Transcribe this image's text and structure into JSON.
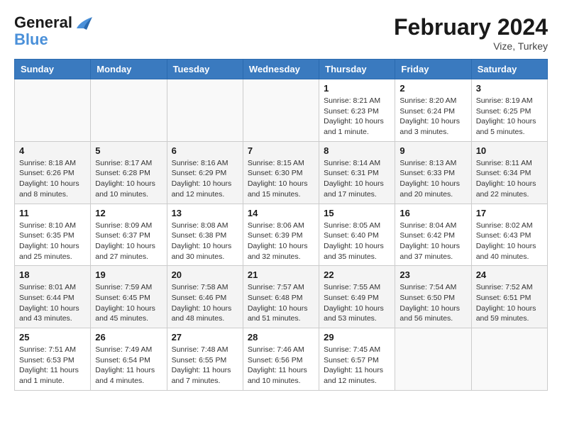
{
  "logo": {
    "line1": "General",
    "line2": "Blue"
  },
  "title": "February 2024",
  "subtitle": "Vize, Turkey",
  "weekdays": [
    "Sunday",
    "Monday",
    "Tuesday",
    "Wednesday",
    "Thursday",
    "Friday",
    "Saturday"
  ],
  "weeks": [
    [
      {
        "day": "",
        "info": ""
      },
      {
        "day": "",
        "info": ""
      },
      {
        "day": "",
        "info": ""
      },
      {
        "day": "",
        "info": ""
      },
      {
        "day": "1",
        "info": "Sunrise: 8:21 AM\nSunset: 6:23 PM\nDaylight: 10 hours\nand 1 minute."
      },
      {
        "day": "2",
        "info": "Sunrise: 8:20 AM\nSunset: 6:24 PM\nDaylight: 10 hours\nand 3 minutes."
      },
      {
        "day": "3",
        "info": "Sunrise: 8:19 AM\nSunset: 6:25 PM\nDaylight: 10 hours\nand 5 minutes."
      }
    ],
    [
      {
        "day": "4",
        "info": "Sunrise: 8:18 AM\nSunset: 6:26 PM\nDaylight: 10 hours\nand 8 minutes."
      },
      {
        "day": "5",
        "info": "Sunrise: 8:17 AM\nSunset: 6:28 PM\nDaylight: 10 hours\nand 10 minutes."
      },
      {
        "day": "6",
        "info": "Sunrise: 8:16 AM\nSunset: 6:29 PM\nDaylight: 10 hours\nand 12 minutes."
      },
      {
        "day": "7",
        "info": "Sunrise: 8:15 AM\nSunset: 6:30 PM\nDaylight: 10 hours\nand 15 minutes."
      },
      {
        "day": "8",
        "info": "Sunrise: 8:14 AM\nSunset: 6:31 PM\nDaylight: 10 hours\nand 17 minutes."
      },
      {
        "day": "9",
        "info": "Sunrise: 8:13 AM\nSunset: 6:33 PM\nDaylight: 10 hours\nand 20 minutes."
      },
      {
        "day": "10",
        "info": "Sunrise: 8:11 AM\nSunset: 6:34 PM\nDaylight: 10 hours\nand 22 minutes."
      }
    ],
    [
      {
        "day": "11",
        "info": "Sunrise: 8:10 AM\nSunset: 6:35 PM\nDaylight: 10 hours\nand 25 minutes."
      },
      {
        "day": "12",
        "info": "Sunrise: 8:09 AM\nSunset: 6:37 PM\nDaylight: 10 hours\nand 27 minutes."
      },
      {
        "day": "13",
        "info": "Sunrise: 8:08 AM\nSunset: 6:38 PM\nDaylight: 10 hours\nand 30 minutes."
      },
      {
        "day": "14",
        "info": "Sunrise: 8:06 AM\nSunset: 6:39 PM\nDaylight: 10 hours\nand 32 minutes."
      },
      {
        "day": "15",
        "info": "Sunrise: 8:05 AM\nSunset: 6:40 PM\nDaylight: 10 hours\nand 35 minutes."
      },
      {
        "day": "16",
        "info": "Sunrise: 8:04 AM\nSunset: 6:42 PM\nDaylight: 10 hours\nand 37 minutes."
      },
      {
        "day": "17",
        "info": "Sunrise: 8:02 AM\nSunset: 6:43 PM\nDaylight: 10 hours\nand 40 minutes."
      }
    ],
    [
      {
        "day": "18",
        "info": "Sunrise: 8:01 AM\nSunset: 6:44 PM\nDaylight: 10 hours\nand 43 minutes."
      },
      {
        "day": "19",
        "info": "Sunrise: 7:59 AM\nSunset: 6:45 PM\nDaylight: 10 hours\nand 45 minutes."
      },
      {
        "day": "20",
        "info": "Sunrise: 7:58 AM\nSunset: 6:46 PM\nDaylight: 10 hours\nand 48 minutes."
      },
      {
        "day": "21",
        "info": "Sunrise: 7:57 AM\nSunset: 6:48 PM\nDaylight: 10 hours\nand 51 minutes."
      },
      {
        "day": "22",
        "info": "Sunrise: 7:55 AM\nSunset: 6:49 PM\nDaylight: 10 hours\nand 53 minutes."
      },
      {
        "day": "23",
        "info": "Sunrise: 7:54 AM\nSunset: 6:50 PM\nDaylight: 10 hours\nand 56 minutes."
      },
      {
        "day": "24",
        "info": "Sunrise: 7:52 AM\nSunset: 6:51 PM\nDaylight: 10 hours\nand 59 minutes."
      }
    ],
    [
      {
        "day": "25",
        "info": "Sunrise: 7:51 AM\nSunset: 6:53 PM\nDaylight: 11 hours\nand 1 minute."
      },
      {
        "day": "26",
        "info": "Sunrise: 7:49 AM\nSunset: 6:54 PM\nDaylight: 11 hours\nand 4 minutes."
      },
      {
        "day": "27",
        "info": "Sunrise: 7:48 AM\nSunset: 6:55 PM\nDaylight: 11 hours\nand 7 minutes."
      },
      {
        "day": "28",
        "info": "Sunrise: 7:46 AM\nSunset: 6:56 PM\nDaylight: 11 hours\nand 10 minutes."
      },
      {
        "day": "29",
        "info": "Sunrise: 7:45 AM\nSunset: 6:57 PM\nDaylight: 11 hours\nand 12 minutes."
      },
      {
        "day": "",
        "info": ""
      },
      {
        "day": "",
        "info": ""
      }
    ]
  ]
}
